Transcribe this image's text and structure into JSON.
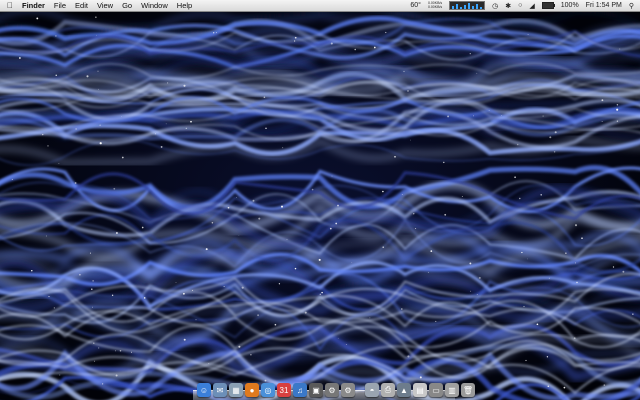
{
  "menubar": {
    "apple_icon": "apple-logo-icon",
    "app_name": "Finder",
    "menus": [
      "File",
      "Edit",
      "View",
      "Go",
      "Window",
      "Help"
    ],
    "status": {
      "temperature": "60°",
      "net_up": "0.00KB/s",
      "net_down": "0.00KB/s",
      "battery_percent": "100%",
      "clock": "Fri 1:54 PM",
      "icons": [
        "time-machine-icon",
        "bluetooth-icon",
        "wifi-icon",
        "volume-icon",
        "battery-icon",
        "spotlight-icon"
      ]
    }
  },
  "dock": {
    "apps": [
      {
        "name": "finder-icon",
        "glyph": "☺",
        "color": "#3b7fd9"
      },
      {
        "name": "mail-icon",
        "glyph": "✉",
        "color": "#6c8fb8"
      },
      {
        "name": "preview-icon",
        "glyph": "▦",
        "color": "#8aa0b4"
      },
      {
        "name": "firefox-icon",
        "glyph": "●",
        "color": "#e07a1e"
      },
      {
        "name": "safari-icon",
        "glyph": "◎",
        "color": "#4a90d9"
      },
      {
        "name": "ical-icon",
        "glyph": "31",
        "color": "#d84040"
      },
      {
        "name": "itunes-icon",
        "glyph": "♫",
        "color": "#3a78c8"
      },
      {
        "name": "photo-icon",
        "glyph": "▣",
        "color": "#5a5a5a"
      },
      {
        "name": "utility-icon",
        "glyph": "⚙",
        "color": "#777777"
      },
      {
        "name": "system-preferences-icon",
        "glyph": "⚙",
        "color": "#8a8a8a"
      }
    ],
    "docs": [
      {
        "name": "app-folder-icon",
        "glyph": "◓",
        "color": "#9aa4b0"
      },
      {
        "name": "printer-icon",
        "glyph": "⎙",
        "color": "#b0b0b0"
      },
      {
        "name": "downloads-stack-icon",
        "glyph": "▲",
        "color": "#6d7c8c"
      },
      {
        "name": "document-icon",
        "glyph": "▤",
        "color": "#c8c8c8"
      },
      {
        "name": "drive-icon",
        "glyph": "▭",
        "color": "#888888"
      },
      {
        "name": "stack-icon",
        "glyph": "▥",
        "color": "#a0a0a0"
      },
      {
        "name": "trash-icon",
        "glyph": "🗑",
        "color": "#9a9a9a"
      }
    ]
  }
}
